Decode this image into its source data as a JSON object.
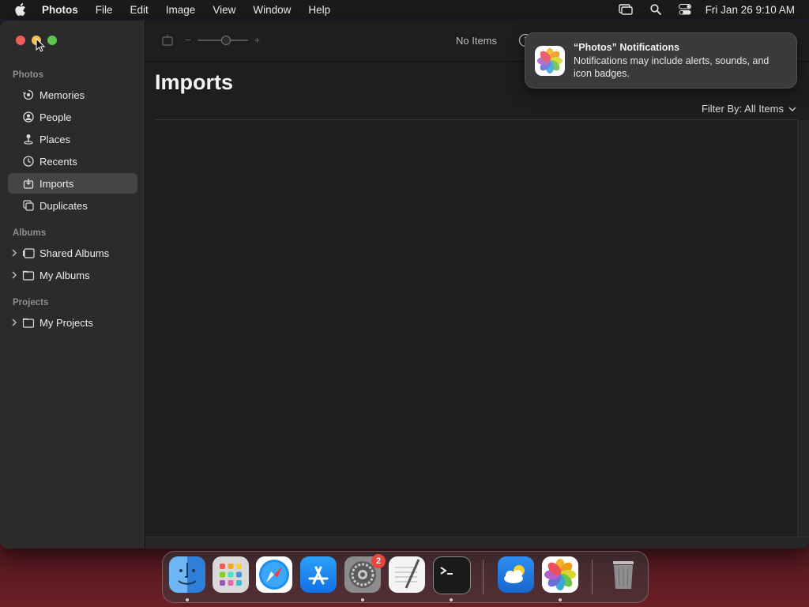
{
  "menubar": {
    "app_name": "Photos",
    "items": [
      "File",
      "Edit",
      "Image",
      "View",
      "Window",
      "Help"
    ],
    "clock": "Fri Jan 26  9:10 AM"
  },
  "sidebar": {
    "sections": [
      {
        "label": "Photos"
      },
      {
        "label": "Albums"
      },
      {
        "label": "Projects"
      }
    ],
    "photos_items": [
      {
        "label": "Memories",
        "icon": "memories-icon"
      },
      {
        "label": "People",
        "icon": "people-icon"
      },
      {
        "label": "Places",
        "icon": "places-icon"
      },
      {
        "label": "Recents",
        "icon": "recents-icon"
      },
      {
        "label": "Imports",
        "icon": "imports-icon",
        "selected": true
      },
      {
        "label": "Duplicates",
        "icon": "duplicates-icon"
      }
    ],
    "album_items": [
      {
        "label": "Shared Albums",
        "icon": "shared-albums-icon"
      },
      {
        "label": "My Albums",
        "icon": "folder-icon"
      }
    ],
    "project_items": [
      {
        "label": "My Projects",
        "icon": "folder-icon"
      }
    ]
  },
  "toolbar": {
    "zoom_minus": "−",
    "zoom_plus": "+",
    "item_count": "No Items"
  },
  "main": {
    "title": "Imports",
    "filter_label": "Filter By: All Items"
  },
  "notification": {
    "title": "“Photos” Notifications",
    "body": "Notifications may include alerts, sounds, and icon badges."
  },
  "dock": {
    "apps": [
      "Finder",
      "Launchpad",
      "Safari",
      "App Store",
      "System Settings",
      "TextEdit",
      "Terminal",
      "Weather",
      "Photos",
      "Trash"
    ],
    "settings_badge": "2"
  }
}
